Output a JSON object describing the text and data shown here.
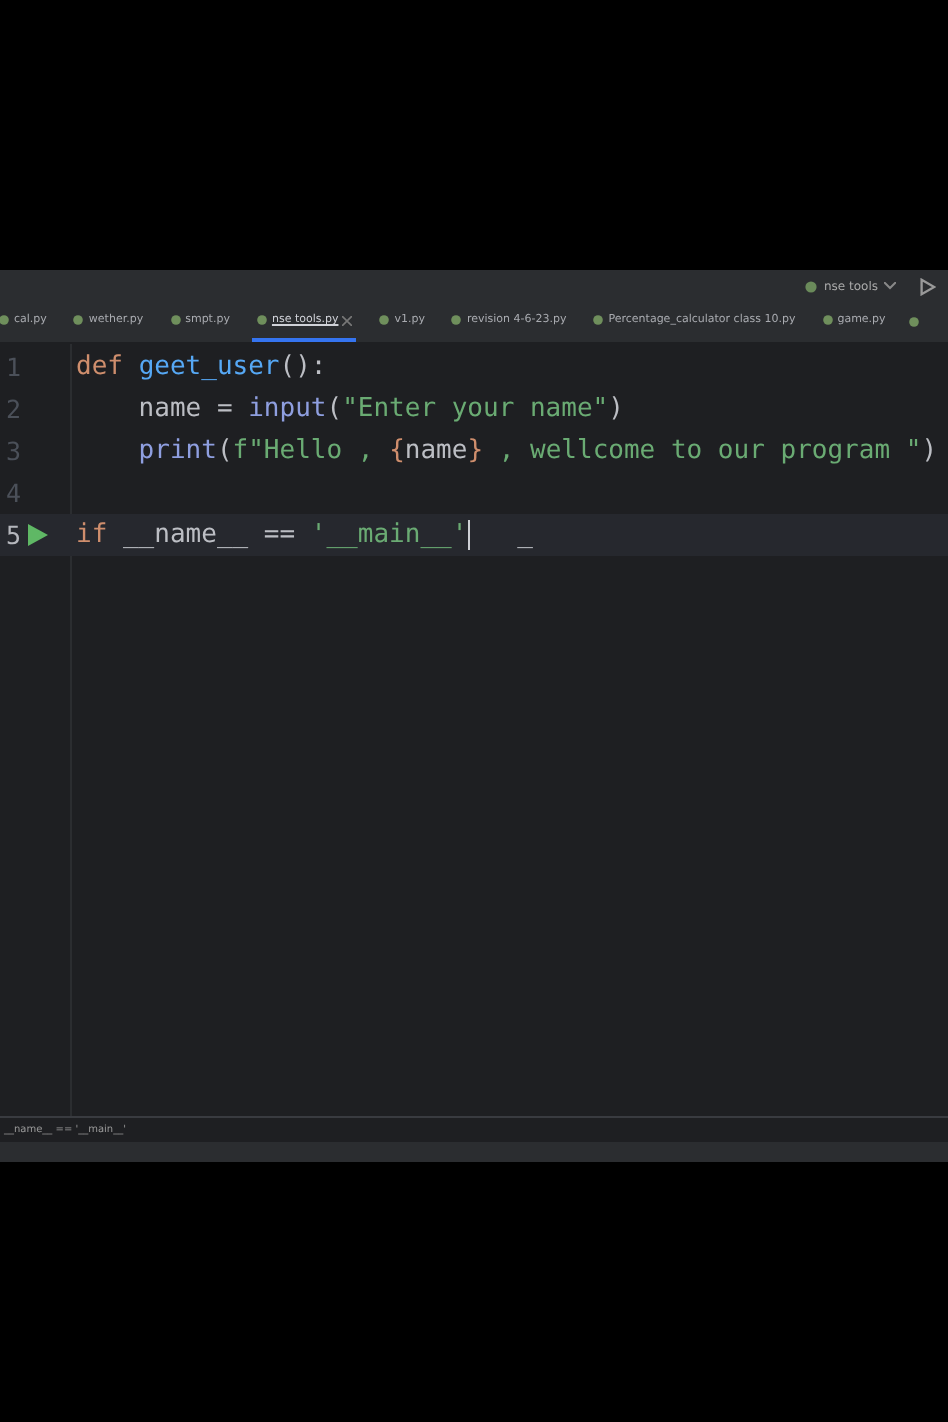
{
  "toolbar": {
    "run_config": "nse tools"
  },
  "tabs": [
    {
      "label": "cal.py",
      "selected": false,
      "closable": false
    },
    {
      "label": "wether.py",
      "selected": false,
      "closable": false
    },
    {
      "label": "smpt.py",
      "selected": false,
      "closable": false
    },
    {
      "label": "nse tools.py",
      "selected": true,
      "closable": true
    },
    {
      "label": "v1.py",
      "selected": false,
      "closable": false
    },
    {
      "label": "revision 4-6-23.py",
      "selected": false,
      "closable": false
    },
    {
      "label": "Percentage_calculator class 10.py",
      "selected": false,
      "closable": false
    },
    {
      "label": "game.py",
      "selected": false,
      "closable": false
    }
  ],
  "editor": {
    "lines": [
      {
        "number": "1",
        "current": false,
        "run_marker": false,
        "cursor": false,
        "tokens": [
          {
            "kind": "keyword",
            "text": "def "
          },
          {
            "kind": "function",
            "text": "geet_user"
          },
          {
            "kind": "plain",
            "text": "():"
          }
        ]
      },
      {
        "number": "2",
        "current": false,
        "run_marker": false,
        "cursor": false,
        "tokens": [
          {
            "kind": "plain",
            "text": "    name = "
          },
          {
            "kind": "builtin",
            "text": "input"
          },
          {
            "kind": "plain",
            "text": "("
          },
          {
            "kind": "string",
            "text": "\"Enter your name\""
          },
          {
            "kind": "plain",
            "text": ")"
          }
        ]
      },
      {
        "number": "3",
        "current": false,
        "run_marker": false,
        "cursor": false,
        "tokens": [
          {
            "kind": "builtin",
            "text": "    print"
          },
          {
            "kind": "plain",
            "text": "("
          },
          {
            "kind": "string",
            "text": "f\"Hello , "
          },
          {
            "kind": "brace",
            "text": "{"
          },
          {
            "kind": "plain",
            "text": "name"
          },
          {
            "kind": "brace",
            "text": "}"
          },
          {
            "kind": "string",
            "text": " , wellcome to our program \""
          },
          {
            "kind": "plain",
            "text": ")"
          }
        ]
      },
      {
        "number": "4",
        "current": false,
        "run_marker": false,
        "cursor": false
      },
      {
        "number": "5",
        "current": true,
        "run_marker": true,
        "cursor": true,
        "tokens": [
          {
            "kind": "keyword",
            "text": "if "
          },
          {
            "kind": "plain",
            "text": "__name__ == "
          },
          {
            "kind": "string",
            "text": "'__main__'"
          }
        ],
        "after_cursor": "   _"
      }
    ]
  },
  "breadcrumb": "__name__ == '__main__'"
}
